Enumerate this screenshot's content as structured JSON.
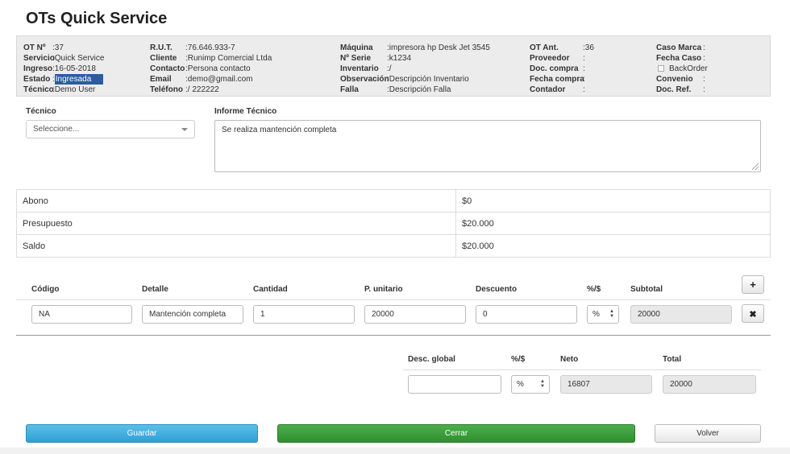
{
  "page": {
    "title": "OTs Quick Service"
  },
  "info": {
    "col1": [
      {
        "k": "OT Nº",
        "v": ":37"
      },
      {
        "k": "Servicio",
        "v": ":Quick Service"
      },
      {
        "k": "Ingreso",
        "v": ":16-05-2018"
      },
      {
        "k": "Estado",
        "v": ":",
        "hl": "Ingresada"
      },
      {
        "k": "Técnico",
        "v": ":Demo User"
      }
    ],
    "col2": [
      {
        "k": "R.U.T.",
        "v": ":76.646.933-7"
      },
      {
        "k": "Cliente",
        "v": ":Runimp Comercial Ltda"
      },
      {
        "k": "Contacto",
        "v": ":Persona contacto"
      },
      {
        "k": "Email",
        "v": ":demo@gmail.com"
      },
      {
        "k": "Teléfono",
        "v": ":/ 222222"
      }
    ],
    "col3": [
      {
        "k": "Máquina",
        "v": ":impresora hp Desk Jet 3545"
      },
      {
        "k": "Nº Serie",
        "v": ":k1234"
      },
      {
        "k": "Inventario",
        "v": ":/"
      },
      {
        "k": "Observación",
        "v": ":Descripción Inventario"
      },
      {
        "k": "Falla",
        "v": ":Descripción Falla"
      }
    ],
    "col4": [
      {
        "k": "OT Ant.",
        "v": ":36"
      },
      {
        "k": "Proveedor",
        "v": ":"
      },
      {
        "k": "Doc. compra",
        "v": ":"
      },
      {
        "k": "Fecha compra",
        "v": ":"
      },
      {
        "k": "Contador",
        "v": ":"
      }
    ],
    "col5": {
      "caso_marca": {
        "k": "Caso Marca",
        "v": ":"
      },
      "fecha_caso": {
        "k": "Fecha Caso",
        "v": ":"
      },
      "backorder": "BackOrder",
      "convenio": {
        "k": "Convenio",
        "v": ":"
      },
      "doc_ref": {
        "k": "Doc. Ref.",
        "v": ":"
      }
    }
  },
  "form": {
    "tecnico_label": "Técnico",
    "tecnico_value": "Seleccione...",
    "informe_label": "Informe Técnico",
    "informe_value": "Se realiza mantención completa"
  },
  "totals": [
    {
      "label": "Abono",
      "value": "$0"
    },
    {
      "label": "Presupuesto",
      "value": "$20.000"
    },
    {
      "label": "Saldo",
      "value": "$20.000"
    }
  ],
  "items_table": {
    "headers": {
      "codigo": "Código",
      "detalle": "Detalle",
      "cantidad": "Cantidad",
      "unitario": "P. unitario",
      "descuento": "Descuento",
      "tipo": "%/$",
      "subtotal": "Subtotal"
    },
    "row": {
      "codigo": "NA",
      "detalle": "Mantención completa",
      "cantidad": "1",
      "unitario": "20000",
      "descuento": "0",
      "tipo": "%",
      "subtotal": "20000"
    },
    "add_icon": "+",
    "remove_icon": "✖"
  },
  "summary": {
    "headers": {
      "desc_global": "Desc. global",
      "tipo": "%/$",
      "neto": "Neto",
      "total": "Total"
    },
    "values": {
      "desc_global": "",
      "tipo": "%",
      "neto": "16807",
      "total": "20000"
    }
  },
  "buttons": {
    "guardar": "Guardar",
    "cerrar": "Cerrar",
    "volver": "Volver"
  }
}
